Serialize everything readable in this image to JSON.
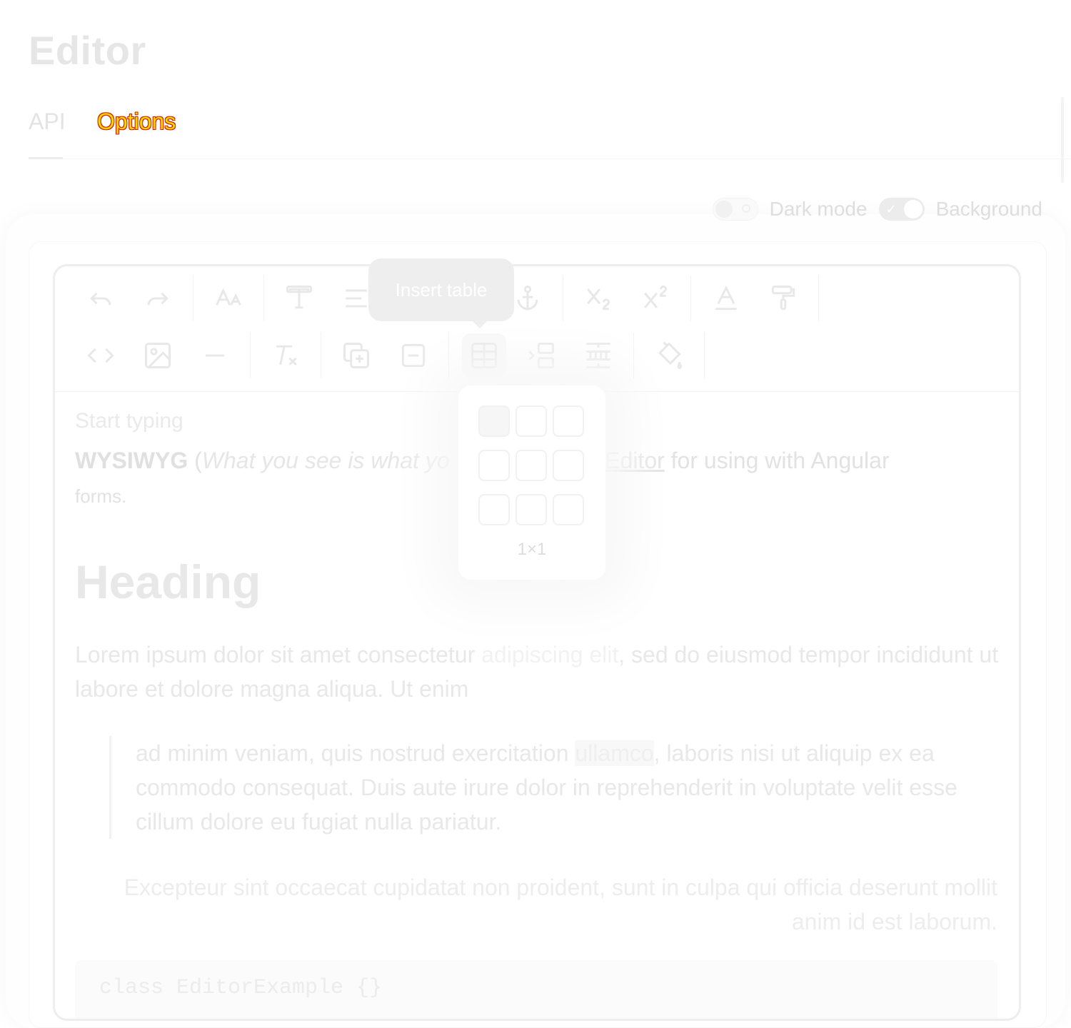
{
  "page": {
    "title": "Editor"
  },
  "tabs": [
    {
      "label": "API"
    },
    {
      "label": "Options"
    }
  ],
  "toggles": {
    "dark_mode": {
      "label": "Dark mode",
      "on": false
    },
    "background": {
      "label": "Background",
      "on": true
    }
  },
  "toolbar": {
    "row1": [
      "undo-icon",
      "redo-icon",
      "font-size-icon",
      "font-style-icon",
      "align-icon",
      "link-icon",
      "anchor-icon",
      "subscript-icon",
      "superscript-icon",
      "text-color-icon",
      "paint-roller-icon"
    ],
    "row2": [
      "code-icon",
      "image-icon",
      "horizontal-rule-icon",
      "clear-format-icon",
      "add-row-icon",
      "remove-row-icon",
      "insert-table-icon",
      "insert-column-icon",
      "merge-cells-icon",
      "cell-fill-icon"
    ],
    "tooltip": "Insert table"
  },
  "table_picker": {
    "rows": 3,
    "cols": 3,
    "selected_rows": 1,
    "selected_cols": 1,
    "size_label": "1×1"
  },
  "content": {
    "placeholder": "Start typing",
    "lead_bold": "WYSIWYG",
    "lead_open": " (",
    "lead_italic": "What you see is what yo",
    "lead_link": "Text Editor",
    "lead_after": " for using with Angular",
    "lead_small": "forms.",
    "heading": "Heading",
    "lorem_before": "Lorem ipsum dolor sit amet consectetur ",
    "lorem_highlight": "adipiscing elit",
    "lorem_after": ", sed do eiusmod tempor incididunt ut labore et dolore magna aliqua. Ut enim",
    "quote_before": "ad minim veniam, quis nostrud exercitation ",
    "quote_code": "ullamco",
    "quote_after": ", laboris nisi ut aliquip ex ea commodo consequat. Duis aute irure dolor in reprehenderit in voluptate velit esse cillum dolore eu fugiat nulla pariatur.",
    "right_aligned": "Excepteur sint occaecat cupidatat non proident, sunt in culpa qui officia deserunt mollit anim id est laborum.",
    "code_block": "class EditorExample {}"
  }
}
